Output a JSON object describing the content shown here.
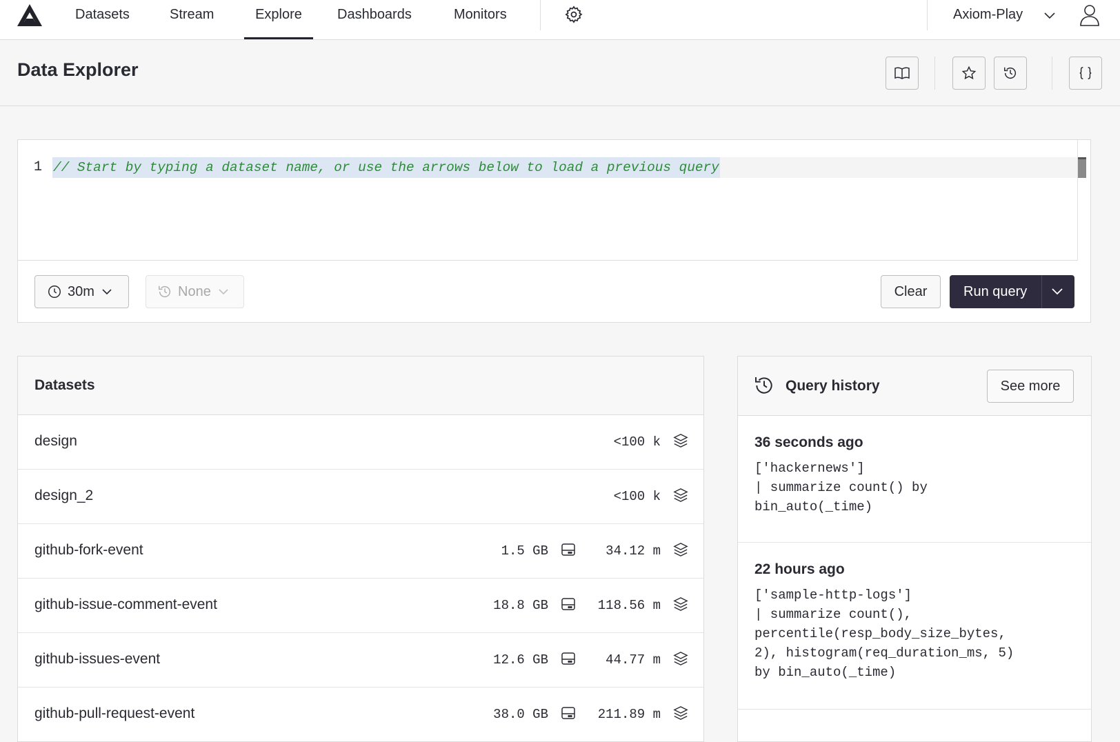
{
  "nav": {
    "logo_icon": "axiom-logo-icon",
    "items": [
      {
        "label": "Datasets",
        "active": false
      },
      {
        "label": "Stream",
        "active": false
      },
      {
        "label": "Explore",
        "active": true
      },
      {
        "label": "Dashboards",
        "active": false
      },
      {
        "label": "Monitors",
        "active": false
      }
    ],
    "settings_icon": "gear-icon",
    "org_name": "Axiom-Play",
    "org_icon": "chevron-down-icon",
    "user_icon": "user-icon"
  },
  "header": {
    "title": "Data Explorer",
    "actions": [
      "book-icon",
      "star-icon",
      "history-icon",
      "braces-icon"
    ]
  },
  "editor": {
    "line_number": "1",
    "placeholder_comment": "// Start by typing a dataset name, or use the arrows below to load a previous query",
    "time_range": "30m",
    "compare": "None",
    "clear_label": "Clear",
    "run_label": "Run query"
  },
  "datasets": {
    "title": "Datasets",
    "rows": [
      {
        "name": "design",
        "size": "",
        "events": "<100 k"
      },
      {
        "name": "design_2",
        "size": "",
        "events": "<100 k"
      },
      {
        "name": "github-fork-event",
        "size": "1.5 GB",
        "events": "34.12 m"
      },
      {
        "name": "github-issue-comment-event",
        "size": "18.8 GB",
        "events": "118.56 m"
      },
      {
        "name": "github-issues-event",
        "size": "12.6 GB",
        "events": "44.77 m"
      },
      {
        "name": "github-pull-request-event",
        "size": "38.0 GB",
        "events": "211.89 m"
      }
    ]
  },
  "history": {
    "title": "Query history",
    "see_more_label": "See more",
    "items": [
      {
        "when": "36 seconds ago",
        "query": "['hackernews']\n| summarize count() by\nbin_auto(_time)"
      },
      {
        "when": "22 hours ago",
        "query": "['sample-http-logs']\n| summarize count(),\npercentile(resp_body_size_bytes,\n2), histogram(req_duration_ms, 5)\nby bin_auto(_time)"
      }
    ]
  },
  "colors": {
    "primary_button": "#2d2b3d",
    "comment_green": "#2e8b3a",
    "selection_blue": "#dde7f3"
  }
}
